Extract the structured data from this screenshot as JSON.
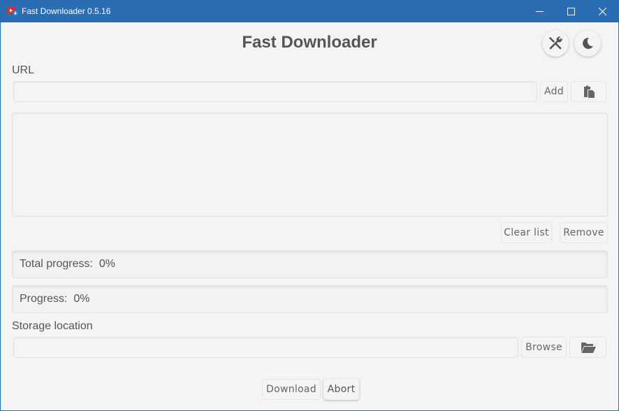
{
  "window": {
    "title": "Fast Downloader 0.5.16",
    "controls": [
      "minimize",
      "maximize",
      "close"
    ]
  },
  "header": {
    "app_title": "Fast Downloader",
    "settings_icon": "tools-icon",
    "theme_icon": "moon-icon"
  },
  "url_section": {
    "label": "URL",
    "input_value": "",
    "input_placeholder": "",
    "add_label": "Add",
    "paste_icon": "clipboard-paste-icon"
  },
  "download_list": {
    "items": [],
    "clear_label": "Clear list",
    "remove_label": "Remove"
  },
  "progress": {
    "total_label": "Total progress:",
    "total_value": "0%",
    "total_fraction": 0,
    "current_label": "Progress:",
    "current_value": "0%",
    "current_fraction": 0
  },
  "storage": {
    "label": "Storage location",
    "input_value": "",
    "browse_label": "Browse",
    "folder_icon": "folder-open-icon"
  },
  "actions": {
    "download_label": "Download",
    "abort_label": "Abort"
  },
  "colors": {
    "titlebar": "#2b6db2",
    "background": "#f4f4f4",
    "text": "#555555",
    "icon": "#666666"
  }
}
